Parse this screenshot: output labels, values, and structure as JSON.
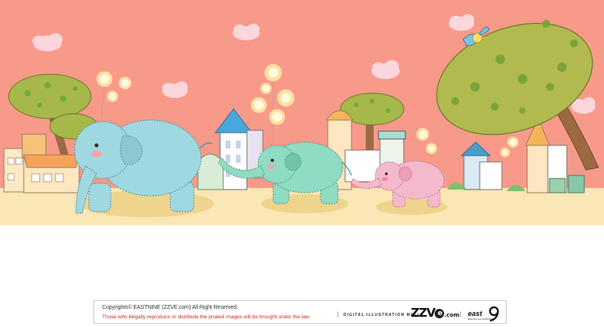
{
  "colors": {
    "sky": "#f79a8a",
    "ground": "#f9e7b5",
    "elephant_blue": "#9fd8e0",
    "elephant_green": "#8fdbc3",
    "elephant_pink": "#f4b9cc",
    "tree_green": "#a7b84a",
    "trunk_brown": "#9c6a42",
    "copyright_red": "#d3271f"
  },
  "footer": {
    "copyright": "Copyrights© EASTNINE (ZZVE.com) All Right Reserved.",
    "warning": "Those who illegally reproduce or distribute the pirated images will be brought under the law.",
    "mall": "DIGITAL ILLUSTRATION MALL",
    "brand_left": "ZZV",
    "brand_e": "e",
    "brand_com": ".com",
    "brand_east": "east",
    "brand_east_sub": "DIGITAL ILLUSTRATION"
  }
}
